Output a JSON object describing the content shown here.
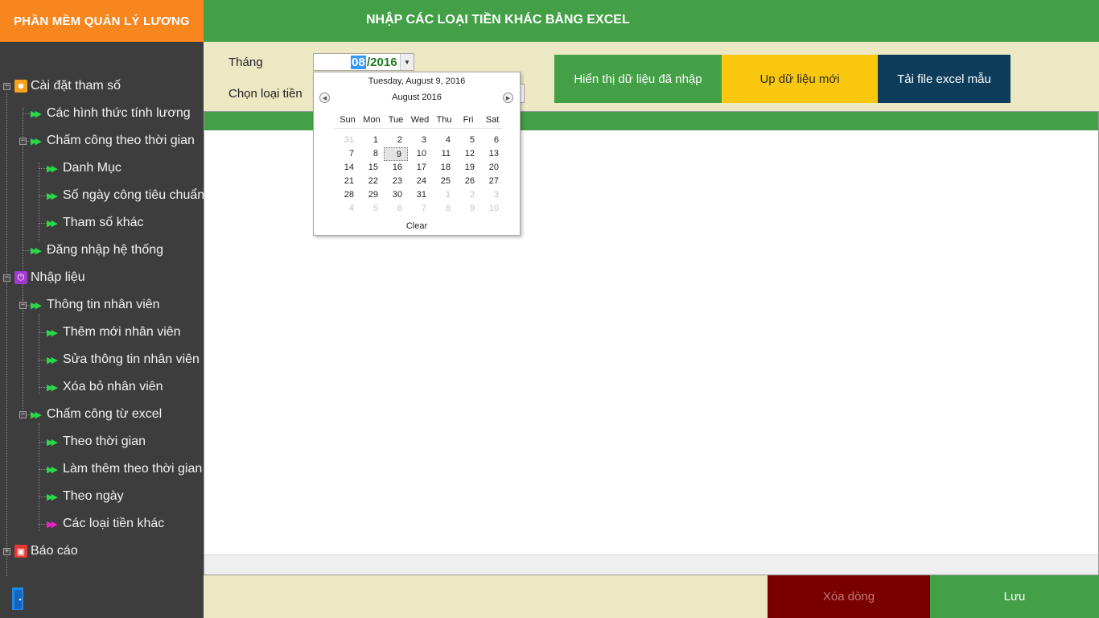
{
  "app": {
    "title": "PHẦN MỀM QUẢN LÝ LƯƠNG"
  },
  "header": {
    "title": "NHẬP CÁC LOẠI TIỀN KHÁC BẰNG EXCEL"
  },
  "form": {
    "month_label": "Tháng",
    "month_value_mm": "08",
    "month_value_yyyy": "/2016",
    "currency_type_label": "Chọn loại tiền"
  },
  "actions": {
    "show_data": "Hiển thị dữ liệu đã nhập",
    "upload_new": "Up dữ liệu mới",
    "download_template": "Tải file excel mẫu"
  },
  "bottom": {
    "delete_row": "Xóa dòng",
    "save": "Lưu"
  },
  "sidebar": {
    "items": [
      {
        "label": "Cài đặt tham số",
        "level": 0,
        "expander": "−",
        "icon": "gear-icon"
      },
      {
        "label": "Các hình thức tính lương",
        "level": 1
      },
      {
        "label": "Chấm công theo thời gian",
        "level": 1,
        "expander": "−"
      },
      {
        "label": "Danh Mục",
        "level": 2
      },
      {
        "label": "Số ngày công tiêu chuẩn",
        "level": 2
      },
      {
        "label": "Tham số khác",
        "level": 2
      },
      {
        "label": "Đăng nhập hệ thống",
        "level": 1
      },
      {
        "label": "Nhập liệu",
        "level": 0,
        "expander": "−",
        "icon": "power-icon"
      },
      {
        "label": "Thông tin nhân viên",
        "level": 1,
        "expander": "−"
      },
      {
        "label": "Thêm mới nhân viên",
        "level": 2
      },
      {
        "label": "Sửa thông tin nhân viên",
        "level": 2
      },
      {
        "label": "Xóa bỏ nhân viên",
        "level": 2
      },
      {
        "label": "Chấm công từ excel",
        "level": 1,
        "expander": "−"
      },
      {
        "label": "Theo thời gian",
        "level": 2
      },
      {
        "label": "Làm thêm theo thời gian",
        "level": 2
      },
      {
        "label": "Theo ngày",
        "level": 2
      },
      {
        "label": "Các loại tiền khác",
        "level": 2,
        "active": true
      },
      {
        "label": "Báo cáo",
        "level": 0,
        "expander": "+",
        "icon": "report-icon"
      }
    ]
  },
  "calendar": {
    "today_text": "Tuesday, August 9, 2016",
    "month_text": "August 2016",
    "weekdays": [
      "Sun",
      "Mon",
      "Tue",
      "Wed",
      "Thu",
      "Fri",
      "Sat"
    ],
    "weeks": [
      [
        "31",
        "1",
        "2",
        "3",
        "4",
        "5",
        "6"
      ],
      [
        "7",
        "8",
        "9",
        "10",
        "11",
        "12",
        "13"
      ],
      [
        "14",
        "15",
        "16",
        "17",
        "18",
        "19",
        "20"
      ],
      [
        "21",
        "22",
        "23",
        "24",
        "25",
        "26",
        "27"
      ],
      [
        "28",
        "29",
        "30",
        "31",
        "1",
        "2",
        "3"
      ],
      [
        "4",
        "5",
        "6",
        "7",
        "8",
        "9",
        "10"
      ]
    ],
    "selected": "9",
    "clear_label": "Clear"
  },
  "colors": {
    "brand_orange": "#f7861f",
    "header_green": "#43a047",
    "sidebar_bg": "#3d3d3d",
    "content_bg": "#ede8c4",
    "upload_yellow": "#f9c80e",
    "template_navy": "#0e3d5c",
    "delete_red": "#7a0000"
  }
}
